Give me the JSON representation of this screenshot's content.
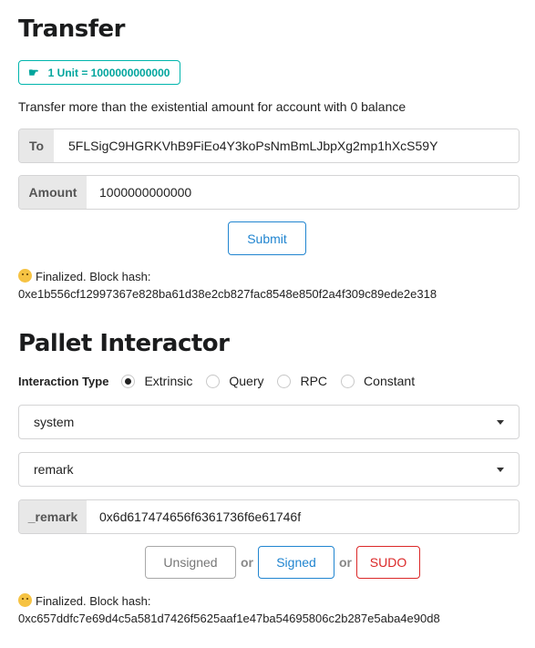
{
  "transfer": {
    "title": "Transfer",
    "unit_badge": "1 Unit = 1000000000000",
    "description": "Transfer more than the existential amount for account with 0 balance",
    "to_label": "To",
    "to_value": "5FLSigC9HGRKVhB9FiEo4Y3koPsNmBmLJbpXg2mp1hXcS59Y",
    "amount_label": "Amount",
    "amount_value": "1000000000000",
    "submit_label": "Submit",
    "status_line": "Finalized. Block hash:",
    "status_hash": "0xe1b556cf12997367e828ba61d38e2cb827fac8548e850f2a4f309c89ede2e318"
  },
  "pallet": {
    "title": "Pallet Interactor",
    "interaction_type_label": "Interaction Type",
    "options": [
      "Extrinsic",
      "Query",
      "RPC",
      "Constant"
    ],
    "selected": "Extrinsic",
    "pallet_select": "system",
    "callable_select": "remark",
    "param_label": "_remark",
    "param_value": "0x6d617474656f6361736f6e61746f",
    "buttons": {
      "unsigned": "Unsigned",
      "signed": "Signed",
      "sudo": "SUDO",
      "or": "or"
    },
    "status_line": "Finalized. Block hash:",
    "status_hash": "0xc657ddfc7e69d4c5a581d7426f5625aaf1e47ba54695806c2b287e5aba4e90d8"
  },
  "colors": {
    "teal": "#00b5ad",
    "blue": "#2185d0",
    "red": "#db2828"
  },
  "icons": {
    "unit": "hand-pointing-icon",
    "status": "smiley-emoji-icon",
    "dropdown": "caret-down-icon"
  }
}
